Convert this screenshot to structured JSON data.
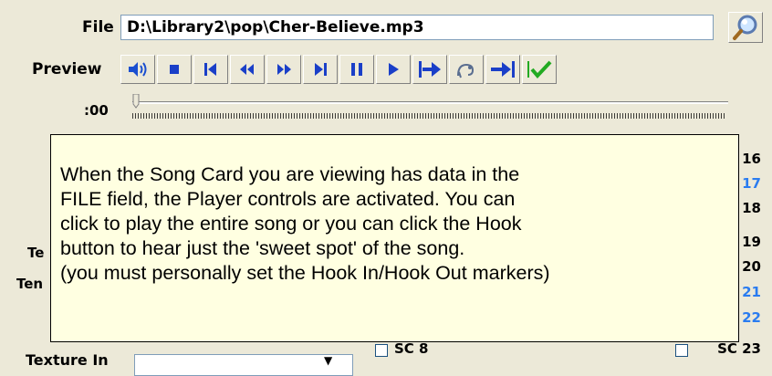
{
  "file": {
    "label": "File",
    "value": "D:\\Library2\\pop\\Cher-Believe.mp3"
  },
  "preview": {
    "label": "Preview"
  },
  "toolbar": {
    "buttons": [
      "speaker-icon",
      "stop-icon",
      "skip-to-start-icon",
      "rewind-icon",
      "fast-forward-icon",
      "skip-to-end-icon",
      "pause-icon",
      "play-icon",
      "play-from-hook-icon",
      "hook-icon",
      "play-to-hook-end-icon",
      "check-icon"
    ]
  },
  "position": {
    "time": ":00"
  },
  "song_cards": {
    "right": [
      "16",
      "17",
      "18",
      "19",
      "20",
      "21",
      "22",
      "SC 23"
    ],
    "left_partial": [
      "SC 8"
    ]
  },
  "side_labels": [
    "Te",
    "Ten"
  ],
  "tooltip": {
    "lines": [
      "When the Song Card you are viewing has data in the",
      "FILE field, the Player controls are activated.  You can",
      "click to play the entire song or you can click the Hook",
      "button to hear just the 'sweet spot' of the song.",
      "(you must personally set the Hook In/Hook Out markers)"
    ]
  },
  "texture_in": {
    "label": "Texture In",
    "value": ""
  },
  "colors": {
    "accent_blue": "#2a7cf0",
    "tooltip_bg": "#ffffe1",
    "window_bg": "#ece9d8",
    "check_green": "#22aa22"
  }
}
